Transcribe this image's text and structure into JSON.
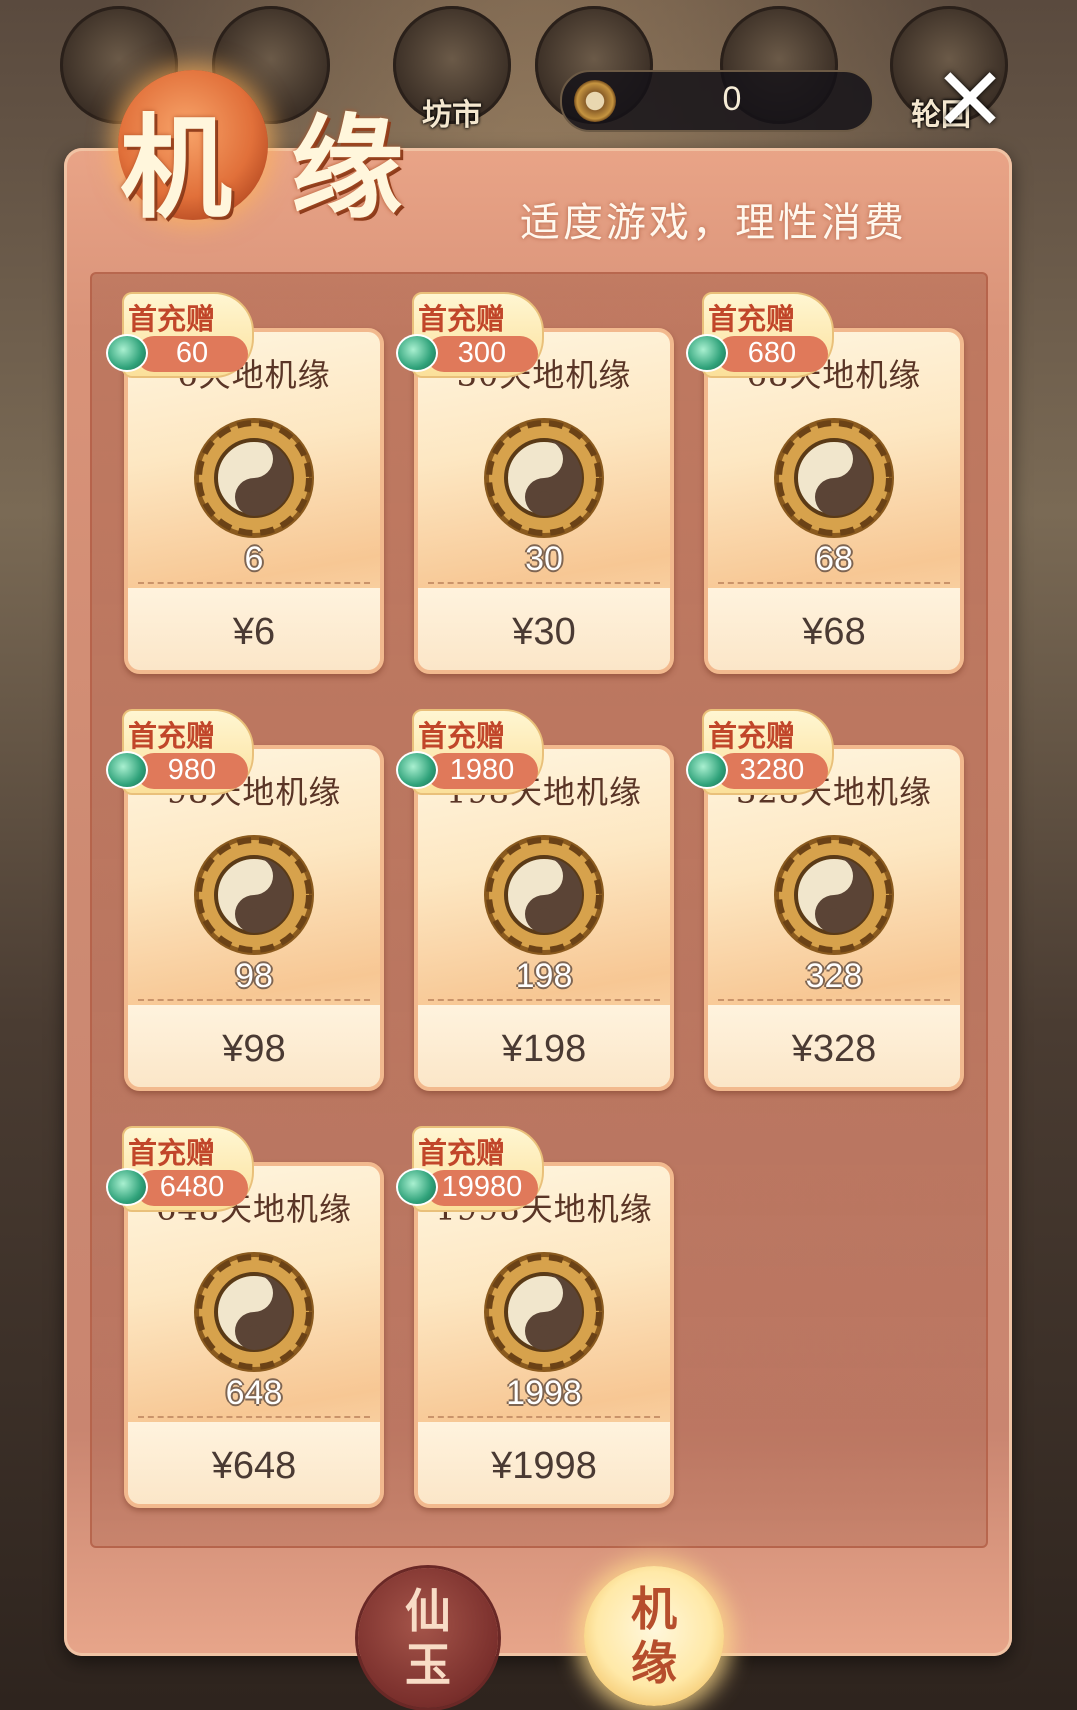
{
  "top_bar": {
    "icons": [
      {
        "label": "",
        "icon": "pouch-icon"
      },
      {
        "label": "",
        "icon": "treasure-icon"
      },
      {
        "label": "坊市",
        "icon": "coin-icon"
      },
      {
        "label": "",
        "icon": "lotus-icon"
      },
      {
        "label": "",
        "icon": "fan-icon"
      },
      {
        "label": "轮回",
        "icon": "temple-icon"
      }
    ],
    "currency": {
      "icon": "taiji-coin-icon",
      "value": "0"
    },
    "close_icon": "close-icon"
  },
  "panel": {
    "title": "机 缘",
    "slogan": "适度游戏，理性消费"
  },
  "cards": [
    {
      "name": "6天地机缘",
      "amount": "6",
      "price": "¥6",
      "bonus_label": "首充赠",
      "bonus_value": "60"
    },
    {
      "name": "30天地机缘",
      "amount": "30",
      "price": "¥30",
      "bonus_label": "首充赠",
      "bonus_value": "300"
    },
    {
      "name": "68天地机缘",
      "amount": "68",
      "price": "¥68",
      "bonus_label": "首充赠",
      "bonus_value": "680"
    },
    {
      "name": "98天地机缘",
      "amount": "98",
      "price": "¥98",
      "bonus_label": "首充赠",
      "bonus_value": "980"
    },
    {
      "name": "198天地机缘",
      "amount": "198",
      "price": "¥198",
      "bonus_label": "首充赠",
      "bonus_value": "1980"
    },
    {
      "name": "328天地机缘",
      "amount": "328",
      "price": "¥328",
      "bonus_label": "首充赠",
      "bonus_value": "3280"
    },
    {
      "name": "648天地机缘",
      "amount": "648",
      "price": "¥648",
      "bonus_label": "首充赠",
      "bonus_value": "6480"
    },
    {
      "name": "1998天地机缘",
      "amount": "1998",
      "price": "¥1998",
      "bonus_label": "首充赠",
      "bonus_value": "19980"
    }
  ],
  "tabs": [
    {
      "label": "仙\n玉",
      "selected": false
    },
    {
      "label": "机\n缘",
      "selected": true
    }
  ],
  "colors": {
    "panel": "#d99379",
    "card": "#fde7c2",
    "bonus_text": "#c1462a",
    "selected_tab": "#ffe9a8"
  }
}
